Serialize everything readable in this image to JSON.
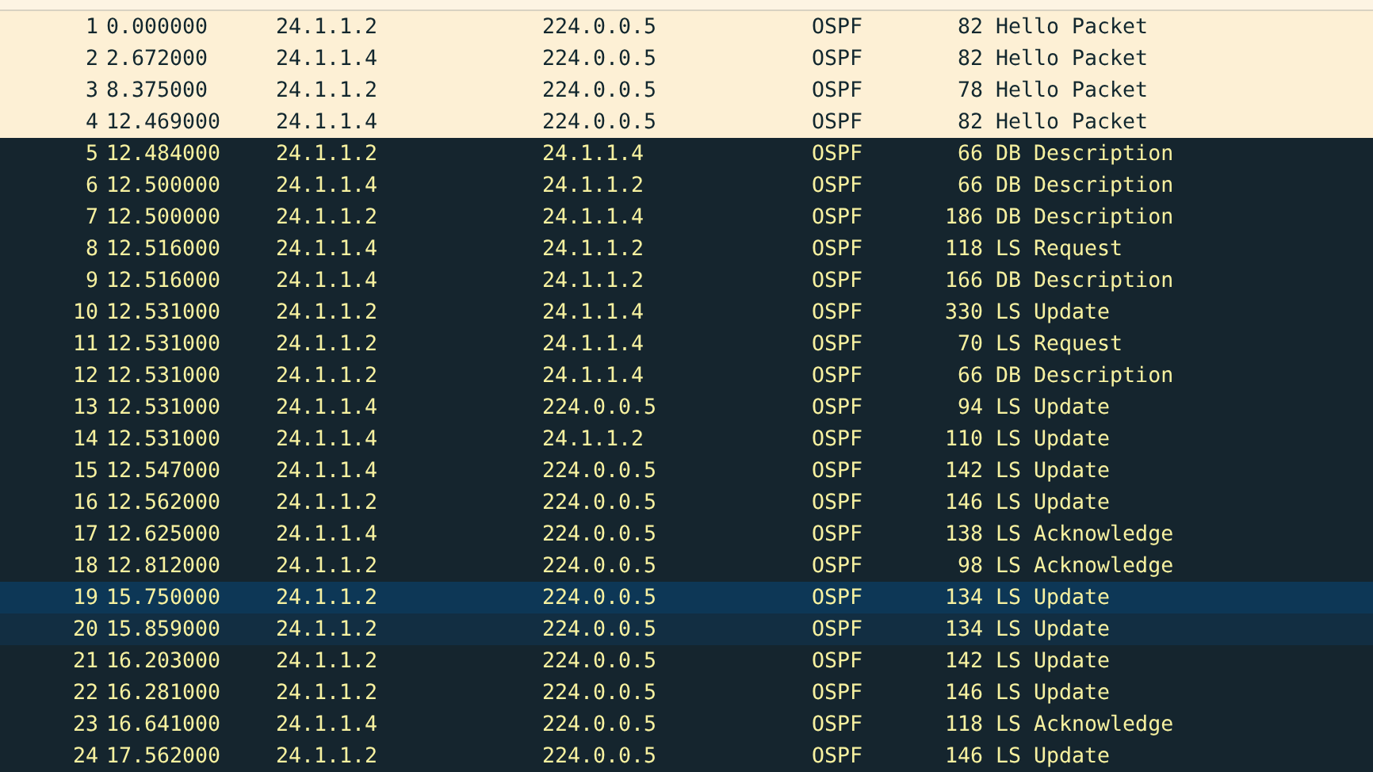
{
  "packets": [
    {
      "no": "1",
      "time": "0.000000",
      "source": "24.1.1.2",
      "destination": "224.0.0.5",
      "protocol": "OSPF",
      "length": "82",
      "info": "Hello Packet",
      "kind": "hello",
      "selected": false
    },
    {
      "no": "2",
      "time": "2.672000",
      "source": "24.1.1.4",
      "destination": "224.0.0.5",
      "protocol": "OSPF",
      "length": "82",
      "info": "Hello Packet",
      "kind": "hello",
      "selected": false
    },
    {
      "no": "3",
      "time": "8.375000",
      "source": "24.1.1.2",
      "destination": "224.0.0.5",
      "protocol": "OSPF",
      "length": "78",
      "info": "Hello Packet",
      "kind": "hello",
      "selected": false
    },
    {
      "no": "4",
      "time": "12.469000",
      "source": "24.1.1.4",
      "destination": "224.0.0.5",
      "protocol": "OSPF",
      "length": "82",
      "info": "Hello Packet",
      "kind": "hello",
      "selected": false
    },
    {
      "no": "5",
      "time": "12.484000",
      "source": "24.1.1.2",
      "destination": "24.1.1.4",
      "protocol": "OSPF",
      "length": "66",
      "info": "DB Description",
      "kind": "plain",
      "selected": false
    },
    {
      "no": "6",
      "time": "12.500000",
      "source": "24.1.1.4",
      "destination": "24.1.1.2",
      "protocol": "OSPF",
      "length": "66",
      "info": "DB Description",
      "kind": "plain",
      "selected": false
    },
    {
      "no": "7",
      "time": "12.500000",
      "source": "24.1.1.2",
      "destination": "24.1.1.4",
      "protocol": "OSPF",
      "length": "186",
      "info": "DB Description",
      "kind": "plain",
      "selected": false
    },
    {
      "no": "8",
      "time": "12.516000",
      "source": "24.1.1.4",
      "destination": "24.1.1.2",
      "protocol": "OSPF",
      "length": "118",
      "info": "LS Request",
      "kind": "plain",
      "selected": false
    },
    {
      "no": "9",
      "time": "12.516000",
      "source": "24.1.1.4",
      "destination": "24.1.1.2",
      "protocol": "OSPF",
      "length": "166",
      "info": "DB Description",
      "kind": "plain",
      "selected": false
    },
    {
      "no": "10",
      "time": "12.531000",
      "source": "24.1.1.2",
      "destination": "24.1.1.4",
      "protocol": "OSPF",
      "length": "330",
      "info": "LS Update",
      "kind": "plain",
      "selected": false
    },
    {
      "no": "11",
      "time": "12.531000",
      "source": "24.1.1.2",
      "destination": "24.1.1.4",
      "protocol": "OSPF",
      "length": "70",
      "info": "LS Request",
      "kind": "plain",
      "selected": false
    },
    {
      "no": "12",
      "time": "12.531000",
      "source": "24.1.1.2",
      "destination": "24.1.1.4",
      "protocol": "OSPF",
      "length": "66",
      "info": "DB Description",
      "kind": "plain",
      "selected": false
    },
    {
      "no": "13",
      "time": "12.531000",
      "source": "24.1.1.4",
      "destination": "224.0.0.5",
      "protocol": "OSPF",
      "length": "94",
      "info": "LS Update",
      "kind": "plain",
      "selected": false
    },
    {
      "no": "14",
      "time": "12.531000",
      "source": "24.1.1.4",
      "destination": "24.1.1.2",
      "protocol": "OSPF",
      "length": "110",
      "info": "LS Update",
      "kind": "plain",
      "selected": false
    },
    {
      "no": "15",
      "time": "12.547000",
      "source": "24.1.1.4",
      "destination": "224.0.0.5",
      "protocol": "OSPF",
      "length": "142",
      "info": "LS Update",
      "kind": "plain",
      "selected": false
    },
    {
      "no": "16",
      "time": "12.562000",
      "source": "24.1.1.2",
      "destination": "224.0.0.5",
      "protocol": "OSPF",
      "length": "146",
      "info": "LS Update",
      "kind": "plain",
      "selected": false
    },
    {
      "no": "17",
      "time": "12.625000",
      "source": "24.1.1.4",
      "destination": "224.0.0.5",
      "protocol": "OSPF",
      "length": "138",
      "info": "LS Acknowledge",
      "kind": "plain",
      "selected": false
    },
    {
      "no": "18",
      "time": "12.812000",
      "source": "24.1.1.2",
      "destination": "224.0.0.5",
      "protocol": "OSPF",
      "length": "98",
      "info": "LS Acknowledge",
      "kind": "plain",
      "selected": false
    },
    {
      "no": "19",
      "time": "15.750000",
      "source": "24.1.1.2",
      "destination": "224.0.0.5",
      "protocol": "OSPF",
      "length": "134",
      "info": "LS Update",
      "kind": "plain",
      "selected": true
    },
    {
      "no": "20",
      "time": "15.859000",
      "source": "24.1.1.2",
      "destination": "224.0.0.5",
      "protocol": "OSPF",
      "length": "134",
      "info": "LS Update",
      "kind": "related",
      "selected": false
    },
    {
      "no": "21",
      "time": "16.203000",
      "source": "24.1.1.2",
      "destination": "224.0.0.5",
      "protocol": "OSPF",
      "length": "142",
      "info": "LS Update",
      "kind": "plain",
      "selected": false
    },
    {
      "no": "22",
      "time": "16.281000",
      "source": "24.1.1.2",
      "destination": "224.0.0.5",
      "protocol": "OSPF",
      "length": "146",
      "info": "LS Update",
      "kind": "plain",
      "selected": false
    },
    {
      "no": "23",
      "time": "16.641000",
      "source": "24.1.1.4",
      "destination": "224.0.0.5",
      "protocol": "OSPF",
      "length": "118",
      "info": "LS Acknowledge",
      "kind": "plain",
      "selected": false
    },
    {
      "no": "24",
      "time": "17.562000",
      "source": "24.1.1.2",
      "destination": "224.0.0.5",
      "protocol": "OSPF",
      "length": "146",
      "info": "LS Update",
      "kind": "plain",
      "selected": false
    }
  ]
}
